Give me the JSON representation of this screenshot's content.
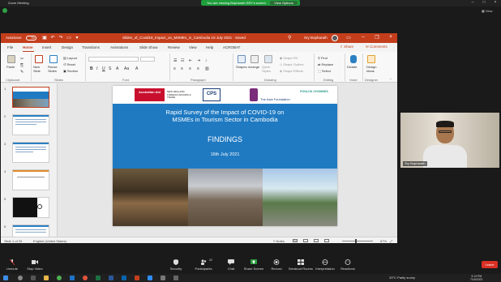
{
  "zoom": {
    "window_title": "Zoom Meeting",
    "share_banner": "You are viewing Bopharath SRY's screen",
    "view_options": "View Options",
    "view_label": "View",
    "participant_name": "Sry Bopharath",
    "leave_label": "Leave",
    "controls": [
      {
        "label": "Unmute"
      },
      {
        "label": "Stop Video"
      },
      {
        "label": "Security"
      },
      {
        "label": "Participants"
      },
      {
        "label": "Chat"
      },
      {
        "label": "Share Screen"
      },
      {
        "label": "Record"
      },
      {
        "label": "Breakout Rooms"
      },
      {
        "label": "Interpretation"
      },
      {
        "label": "Reactions"
      }
    ],
    "participants_count": "22"
  },
  "ppt": {
    "autosave_label": "AutoSave",
    "autosave_state": "On",
    "doc_title": "Slides_of_Covid19_Impact_on_MSMEs_in_Cambodia 16 July 2021 · Saved",
    "user_name": "Sry Bopharath",
    "tabs": [
      "File",
      "Home",
      "Insert",
      "Design",
      "Transitions",
      "Animations",
      "Slide Show",
      "Review",
      "View",
      "Help",
      "ACROBAT"
    ],
    "share": "Share",
    "comments": "Comments",
    "ribbon": {
      "clipboard": "Clipboard",
      "paste": "Paste",
      "slides": "Slides",
      "new_slide": "New Slide",
      "reuse_slides": "Reuse Slides",
      "layout": "Layout",
      "reset": "Reset",
      "section": "Section",
      "font": "Font",
      "paragraph": "Paragraph",
      "drawing": "Drawing",
      "shapes": "Shapes",
      "arrange": "Arrange",
      "quick_styles": "Quick Styles",
      "shape_fill": "Shape Fill",
      "shape_outline": "Shape Outline",
      "shape_effects": "Shape Effects",
      "editing": "Editing",
      "find": "Find",
      "replace": "Replace",
      "select": "Select",
      "voice": "Voice",
      "dictate": "Dictate",
      "designer": "Designer",
      "design_ideas": "Design Ideas"
    },
    "status": {
      "slide_counter": "Slide 1 of 33",
      "language": "English (United States)",
      "notes": "Notes",
      "comments": "Comments",
      "zoom": "67%"
    },
    "thumbnail_numbers": [
      "1",
      "2",
      "3",
      "4",
      "5",
      "6"
    ]
  },
  "slide": {
    "logos": {
      "australian_aid": "Australian Aid",
      "nz": "NEW ZEALAND FOREIGN AFFAIRS & TRADE",
      "cps": "CPS",
      "asia_foundation": "The Asia Foundation",
      "ponlok": "PONLOK CHOMNES"
    },
    "title_line1": "Rapid Survey of the Impact of COVID-19 on",
    "title_line2": "MSMEs in Tourism Sector in Cambodia",
    "findings": "FINDINGS",
    "date": "16th July 2021"
  },
  "taskbar": {
    "weather": "33°C  Partly sunny",
    "time": "3:13 PM",
    "date": "7/16/2021"
  }
}
